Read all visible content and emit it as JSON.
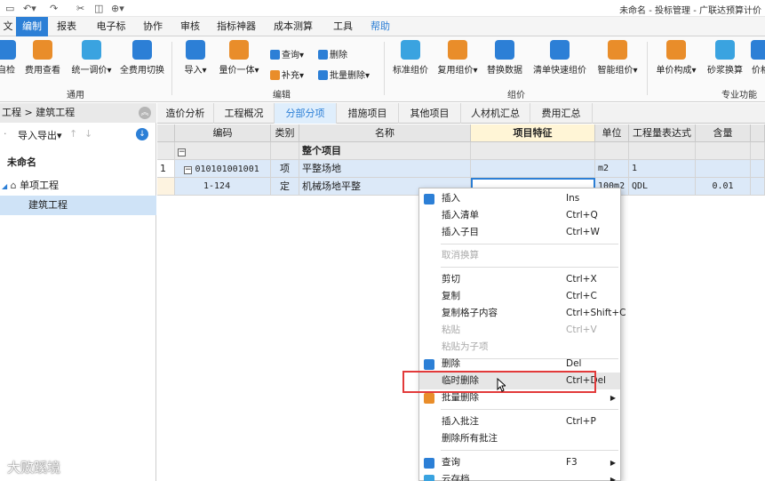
{
  "title": "未命名 - 投标管理 - 广联达预算计价",
  "quick_access": [
    "▭",
    "↶▾",
    "↷",
    "✂",
    "◫",
    "⊕▾"
  ],
  "menu": {
    "items": [
      "文件",
      "编制",
      "报表",
      "电子标",
      "协作",
      "审核",
      "指标神器",
      "成本测算",
      "工具",
      "帮助"
    ],
    "active": "编制"
  },
  "ribbon": {
    "groups": [
      "通用",
      "编辑",
      "组价",
      "专业功能"
    ],
    "buttons": [
      "自检",
      "费用查看",
      "统一调价▾",
      "全费用切换",
      "导入▾",
      "量价一体▾",
      "标准组价",
      "复用组价▾",
      "替换数据",
      "清单快速组价",
      "智能组价▾",
      "单价构成▾",
      "砂浆换算",
      "价格"
    ],
    "small": [
      "查询▾",
      "删除",
      "补充▾",
      "批量删除▾"
    ]
  },
  "sidebar": {
    "breadcrumb": "工程 > 建筑工程",
    "tools": [
      "导入导出▾",
      "↑",
      "↓"
    ],
    "tree": [
      "未命名",
      "单项工程",
      "建筑工程"
    ]
  },
  "tabs": [
    "造价分析",
    "工程概况",
    "分部分项",
    "措施项目",
    "其他项目",
    "人材机汇总",
    "费用汇总"
  ],
  "active_tab": "分部分项",
  "table": {
    "headers": [
      "编码",
      "类别",
      "名称",
      "项目特征",
      "单位",
      "工程量表达式",
      "含量"
    ],
    "rows": [
      {
        "no": "",
        "code": "",
        "type": "",
        "name": "整个项目",
        "feature": "",
        "unit": "",
        "expr": "",
        "content": ""
      },
      {
        "no": "1",
        "code": "010101001001",
        "type": "项",
        "name": "平整场地",
        "feature": "",
        "unit": "m2",
        "expr": "1",
        "content": ""
      },
      {
        "no": "",
        "code": "1-124",
        "type": "定",
        "name": "机械场地平整",
        "feature": "",
        "unit": "100m2",
        "expr": "QDL",
        "content": "0.01"
      }
    ]
  },
  "context_menu": [
    {
      "label": "插入",
      "key": "Ins",
      "icon": "insert-icon",
      "state": "normal"
    },
    {
      "label": "插入清单",
      "key": "Ctrl+Q",
      "state": "normal"
    },
    {
      "label": "插入子目",
      "key": "Ctrl+W",
      "state": "normal"
    },
    {
      "label": "取消换算",
      "key": "",
      "state": "disabled"
    },
    {
      "label": "剪切",
      "key": "Ctrl+X",
      "state": "normal"
    },
    {
      "label": "复制",
      "key": "Ctrl+C",
      "state": "normal"
    },
    {
      "label": "复制格子内容",
      "key": "Ctrl+Shift+C",
      "state": "normal"
    },
    {
      "label": "粘贴",
      "key": "Ctrl+V",
      "state": "disabled"
    },
    {
      "label": "粘贴为子项",
      "key": "",
      "state": "disabled"
    },
    {
      "label": "删除",
      "key": "Del",
      "icon": "trash-icon",
      "state": "normal"
    },
    {
      "label": "临时删除",
      "key": "Ctrl+Del",
      "state": "hover"
    },
    {
      "label": "批量删除",
      "key": "",
      "icon": "batch-delete-icon",
      "state": "submenu"
    },
    {
      "label": "插入批注",
      "key": "Ctrl+P",
      "state": "normal"
    },
    {
      "label": "删除所有批注",
      "key": "",
      "state": "normal"
    },
    {
      "label": "查询",
      "key": "F3",
      "icon": "search-icon",
      "state": "submenu"
    },
    {
      "label": "云存档",
      "key": "",
      "icon": "cloud-icon",
      "state": "submenu"
    }
  ],
  "watermark": "大败蹊境",
  "colors": {
    "accent": "#2c7fd6",
    "highlight_box": "#e23a3a",
    "selected_row": "#dce9f8"
  }
}
